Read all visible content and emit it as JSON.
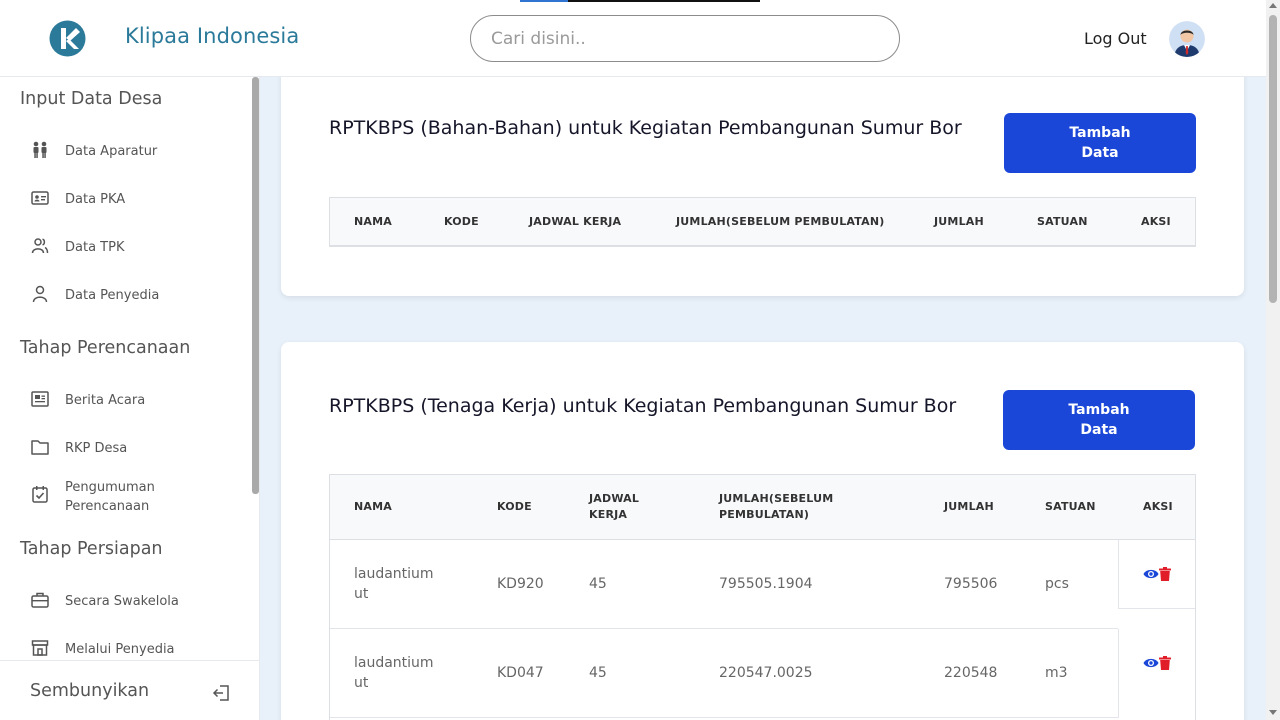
{
  "header": {
    "brand": "Klipaa Indonesia",
    "search_placeholder": "Cari disini..",
    "logout": "Log Out",
    "logo_icon": "klipaa-logo-icon",
    "avatar_icon": "user-avatar-icon"
  },
  "sidebar": {
    "sections": [
      {
        "title": "Input Data Desa",
        "items": [
          {
            "label": "Data Aparatur",
            "icon": "people-icon"
          },
          {
            "label": "Data PKA",
            "icon": "id-card-icon"
          },
          {
            "label": "Data TPK",
            "icon": "users-icon"
          },
          {
            "label": "Data Penyedia",
            "icon": "user-icon"
          }
        ]
      },
      {
        "title": "Tahap Perencanaan",
        "items": [
          {
            "label": "Berita Acara",
            "icon": "news-icon"
          },
          {
            "label": "RKP Desa",
            "icon": "folder-icon"
          },
          {
            "label": "Pengumuman Perencanaan",
            "icon": "calendar-check-icon"
          }
        ]
      },
      {
        "title": "Tahap Persiapan",
        "items": [
          {
            "label": "Secara Swakelola",
            "icon": "briefcase-icon"
          },
          {
            "label": "Melalui Penyedia",
            "icon": "store-icon"
          }
        ]
      }
    ],
    "footer": {
      "label": "Sembunyikan",
      "icon": "logout-arrow-icon"
    }
  },
  "main": {
    "card1": {
      "title": "RPTKBPS (Bahan-Bahan) untuk Kegiatan Pembangunan Sumur Bor",
      "button": {
        "line1": "Tambah",
        "line2": "Data"
      },
      "columns": [
        "NAMA",
        "KODE",
        "JADWAL KERJA",
        "JUMLAH(SEBELUM PEMBULATAN)",
        "JUMLAH",
        "SATUAN",
        "AKSI"
      ]
    },
    "card2": {
      "title": "RPTKBPS (Tenaga Kerja) untuk Kegiatan Pembangunan Sumur Bor",
      "button": {
        "line1": "Tambah",
        "line2": "Data"
      },
      "columns": {
        "nama": "NAMA",
        "kode": "KODE",
        "jadwal_1": "JADWAL",
        "jadwal_2": "KERJA",
        "jumlah_sebelum_1": "JUMLAH(SEBELUM",
        "jumlah_sebelum_2": "PEMBULATAN)",
        "jumlah": "JUMLAH",
        "satuan": "SATUAN",
        "aksi": "AKSI"
      },
      "rows": [
        {
          "nama_1": "laudantium",
          "nama_2": "ut",
          "kode": "KD920",
          "jadwal": "45",
          "jumlah_sebelum": "795505.1904",
          "jumlah": "795506",
          "satuan": "pcs"
        },
        {
          "nama_1": "laudantium",
          "nama_2": "ut",
          "kode": "KD047",
          "jadwal": "45",
          "jumlah_sebelum": "220547.0025",
          "jumlah": "220548",
          "satuan": "m3"
        }
      ]
    }
  },
  "colors": {
    "primary": "#1b47d8",
    "brand": "#2b7a9a",
    "delete": "#e11d2a"
  }
}
